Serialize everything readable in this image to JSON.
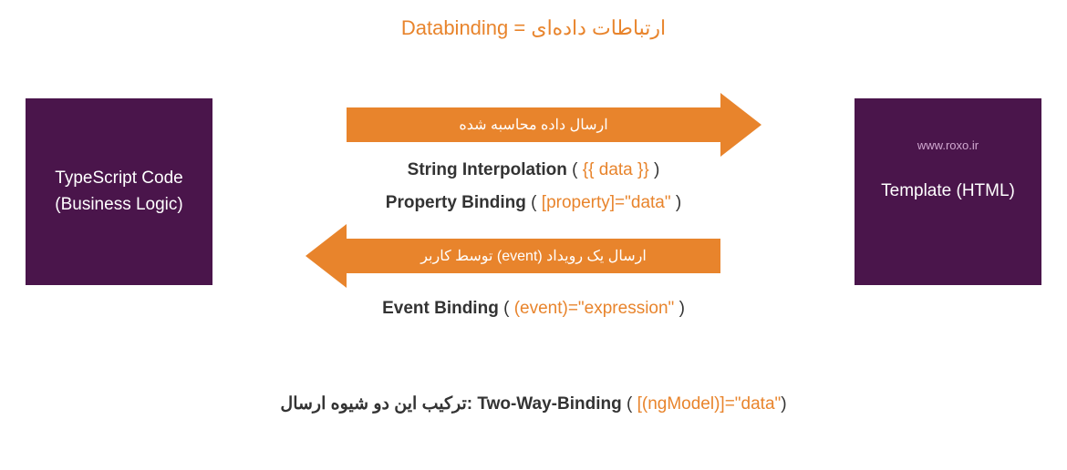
{
  "title": "Databinding = ارتباطات داده‌ای",
  "leftBox": {
    "line1": "TypeScript Code",
    "line2": "(Business Logic)"
  },
  "rightBox": {
    "watermark": "www.roxo.ir",
    "line1": "Template (HTML)"
  },
  "arrowRight": "ارسال داده محاسبه شده",
  "arrowLeft": "ارسال یک رویداد (event) توسط کاربر",
  "methods": {
    "stringInterpolation": {
      "name": "String Interpolation",
      "lparen": " ( ",
      "code": "{{ data }}",
      "rparen": " )"
    },
    "propertyBinding": {
      "name": "Property Binding",
      "lparen": " ( ",
      "code": "[property]=\"data\"",
      "rparen": " )"
    },
    "eventBinding": {
      "name": "Event Binding",
      "lparen": " ( ",
      "code": "(event)=\"expression\"",
      "rparen": " )"
    },
    "twoWay": {
      "prefix": "ترکیب این دو شیوه ارسال:",
      "space": "   ",
      "name": "Two-Way-Binding",
      "lparen": " ( ",
      "code": "[(ngModel)]=\"data\"",
      "rparen": ")"
    }
  }
}
